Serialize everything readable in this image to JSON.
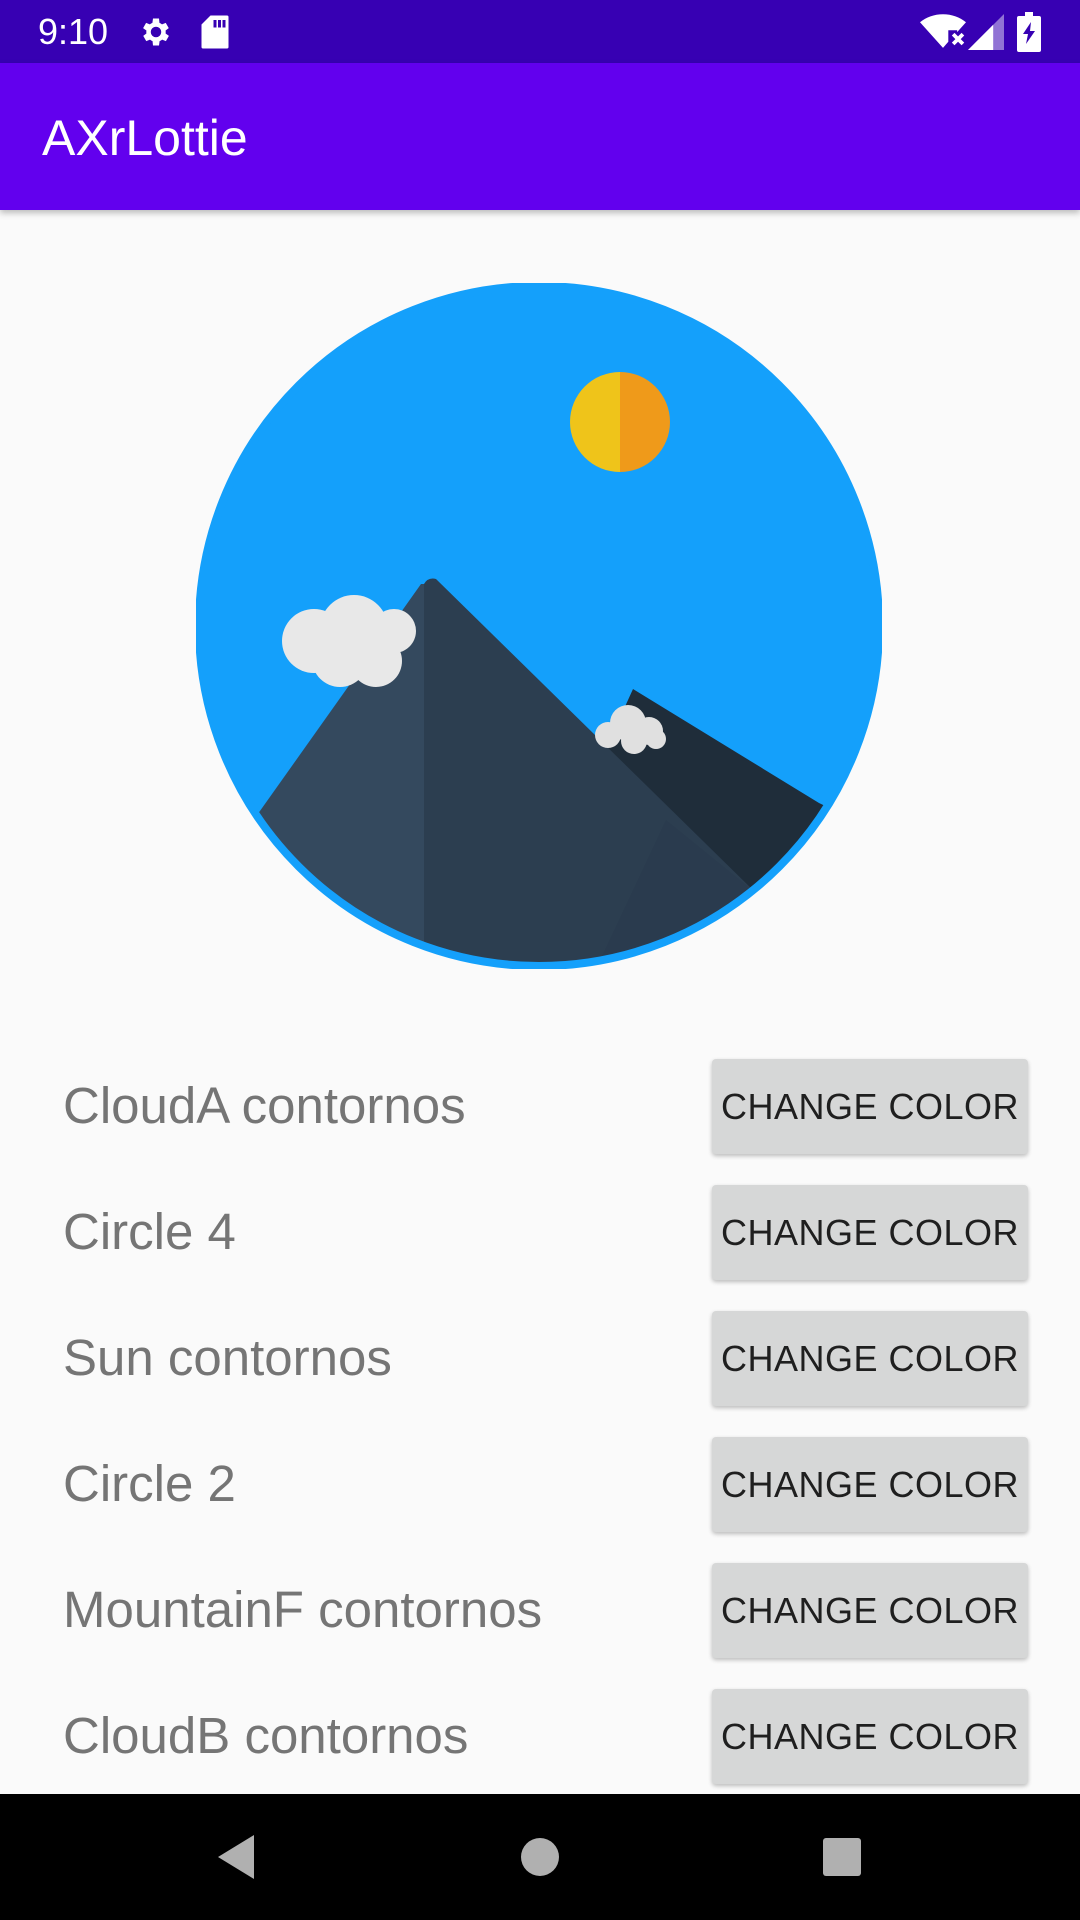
{
  "status_bar": {
    "time": "9:10",
    "icons_left": [
      "settings-gear-icon",
      "sd-card-icon"
    ],
    "icons_right": [
      "wifi-no-internet-icon",
      "cell-signal-icon",
      "battery-charging-icon"
    ]
  },
  "app_bar": {
    "title": "AXrLottie",
    "color": "#6200ee"
  },
  "illustration": {
    "icon": "mountain-landscape-lottie-animation",
    "colors": {
      "sky": "#14a0fb",
      "sun_left": "#efc41a",
      "sun_right": "#ef9a1a",
      "mountain_front_left": "#34495e",
      "mountain_front_right": "#2c3e50",
      "mountain_back": "#1f2d3a",
      "cloud": "#e8e8e8"
    }
  },
  "layers": [
    {
      "name": "CloudA contornos",
      "button": "CHANGE COLOR"
    },
    {
      "name": "Circle 4",
      "button": "CHANGE COLOR"
    },
    {
      "name": "Sun contornos",
      "button": "CHANGE COLOR"
    },
    {
      "name": "Circle 2",
      "button": "CHANGE COLOR"
    },
    {
      "name": "MountainF contornos",
      "button": "CHANGE COLOR"
    },
    {
      "name": "CloudB contornos",
      "button": "CHANGE COLOR"
    }
  ],
  "nav_bar": {
    "back": "back-triangle-icon",
    "home": "home-circle-icon",
    "recents": "recents-square-icon"
  }
}
